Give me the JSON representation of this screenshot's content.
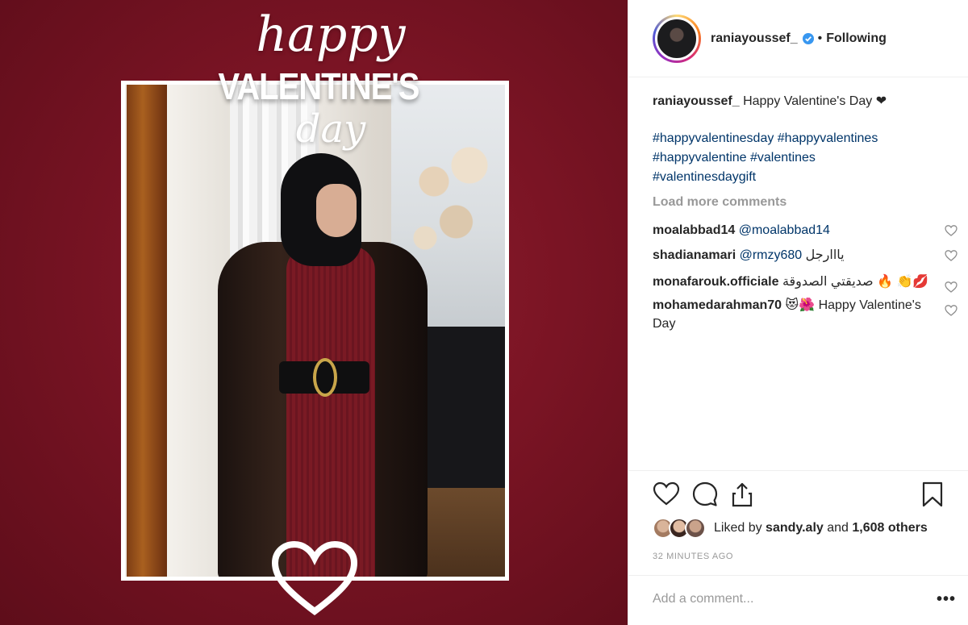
{
  "media": {
    "title_top": "happy",
    "title_main": "VALENTINE'S",
    "title_bottom": "day",
    "background": "#7a1424",
    "frame": "#ffffff"
  },
  "header": {
    "username": "raniayoussef_",
    "separator": "•",
    "follow_status": "Following",
    "verified_icon": "verified-badge-icon"
  },
  "caption": {
    "username": "raniayoussef_",
    "text": "Happy Valentine's Day ❤",
    "hashtags_line1": "#happyvalentinesday #happyvalentines",
    "hashtags_line2": "#happyvalentine #valentines",
    "hashtags_line3": "#valentinesdaygift"
  },
  "load_more": "Load more comments",
  "comments": [
    {
      "username": "moalabbad14",
      "mention": "@moalabbad14",
      "text": ""
    },
    {
      "username": "shadianamari",
      "mention": "@rmzy680",
      "text": "يااارجل"
    },
    {
      "username": "monafarouk.officiale",
      "mention": "",
      "text": "صديقتي الصدوقة 🔥 👏💋"
    },
    {
      "username": "mohamedarahman70",
      "mention": "",
      "text": "😻🌺 Happy Valentine's Day"
    }
  ],
  "likes": {
    "prefix": "Liked by",
    "user": "sandy.aly",
    "joiner": "and",
    "others": "1,608 others"
  },
  "timestamp": "32 MINUTES AGO",
  "add_comment_placeholder": "Add a comment...",
  "more_label": "•••",
  "colors": {
    "link": "#003569",
    "muted": "#999999",
    "text": "#262626",
    "border": "#efefef",
    "verified": "#3897f0"
  }
}
